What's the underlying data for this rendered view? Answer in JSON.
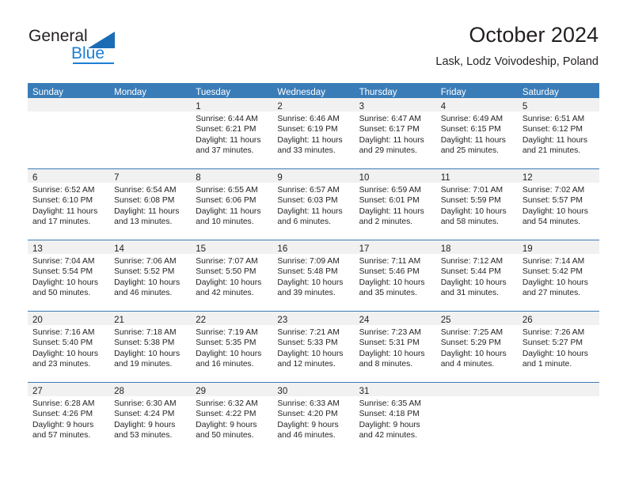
{
  "brand": {
    "name_primary": "General",
    "name_secondary": "Blue",
    "logo_icon": "blue-triangle-icon",
    "accent_color": "#1b7fd4"
  },
  "header": {
    "title": "October 2024",
    "subtitle": "Lask, Lodz Voivodeship, Poland"
  },
  "colors": {
    "header_bar": "#3a7cb8",
    "day_band": "#f1f1f1",
    "text": "#231f20"
  },
  "weekdays": [
    "Sunday",
    "Monday",
    "Tuesday",
    "Wednesday",
    "Thursday",
    "Friday",
    "Saturday"
  ],
  "weeks": [
    [
      {
        "day": "",
        "sunrise": "",
        "sunset": "",
        "daylight": "",
        "daylight2": ""
      },
      {
        "day": "",
        "sunrise": "",
        "sunset": "",
        "daylight": "",
        "daylight2": ""
      },
      {
        "day": "1",
        "sunrise": "Sunrise: 6:44 AM",
        "sunset": "Sunset: 6:21 PM",
        "daylight": "Daylight: 11 hours",
        "daylight2": "and 37 minutes."
      },
      {
        "day": "2",
        "sunrise": "Sunrise: 6:46 AM",
        "sunset": "Sunset: 6:19 PM",
        "daylight": "Daylight: 11 hours",
        "daylight2": "and 33 minutes."
      },
      {
        "day": "3",
        "sunrise": "Sunrise: 6:47 AM",
        "sunset": "Sunset: 6:17 PM",
        "daylight": "Daylight: 11 hours",
        "daylight2": "and 29 minutes."
      },
      {
        "day": "4",
        "sunrise": "Sunrise: 6:49 AM",
        "sunset": "Sunset: 6:15 PM",
        "daylight": "Daylight: 11 hours",
        "daylight2": "and 25 minutes."
      },
      {
        "day": "5",
        "sunrise": "Sunrise: 6:51 AM",
        "sunset": "Sunset: 6:12 PM",
        "daylight": "Daylight: 11 hours",
        "daylight2": "and 21 minutes."
      }
    ],
    [
      {
        "day": "6",
        "sunrise": "Sunrise: 6:52 AM",
        "sunset": "Sunset: 6:10 PM",
        "daylight": "Daylight: 11 hours",
        "daylight2": "and 17 minutes."
      },
      {
        "day": "7",
        "sunrise": "Sunrise: 6:54 AM",
        "sunset": "Sunset: 6:08 PM",
        "daylight": "Daylight: 11 hours",
        "daylight2": "and 13 minutes."
      },
      {
        "day": "8",
        "sunrise": "Sunrise: 6:55 AM",
        "sunset": "Sunset: 6:06 PM",
        "daylight": "Daylight: 11 hours",
        "daylight2": "and 10 minutes."
      },
      {
        "day": "9",
        "sunrise": "Sunrise: 6:57 AM",
        "sunset": "Sunset: 6:03 PM",
        "daylight": "Daylight: 11 hours",
        "daylight2": "and 6 minutes."
      },
      {
        "day": "10",
        "sunrise": "Sunrise: 6:59 AM",
        "sunset": "Sunset: 6:01 PM",
        "daylight": "Daylight: 11 hours",
        "daylight2": "and 2 minutes."
      },
      {
        "day": "11",
        "sunrise": "Sunrise: 7:01 AM",
        "sunset": "Sunset: 5:59 PM",
        "daylight": "Daylight: 10 hours",
        "daylight2": "and 58 minutes."
      },
      {
        "day": "12",
        "sunrise": "Sunrise: 7:02 AM",
        "sunset": "Sunset: 5:57 PM",
        "daylight": "Daylight: 10 hours",
        "daylight2": "and 54 minutes."
      }
    ],
    [
      {
        "day": "13",
        "sunrise": "Sunrise: 7:04 AM",
        "sunset": "Sunset: 5:54 PM",
        "daylight": "Daylight: 10 hours",
        "daylight2": "and 50 minutes."
      },
      {
        "day": "14",
        "sunrise": "Sunrise: 7:06 AM",
        "sunset": "Sunset: 5:52 PM",
        "daylight": "Daylight: 10 hours",
        "daylight2": "and 46 minutes."
      },
      {
        "day": "15",
        "sunrise": "Sunrise: 7:07 AM",
        "sunset": "Sunset: 5:50 PM",
        "daylight": "Daylight: 10 hours",
        "daylight2": "and 42 minutes."
      },
      {
        "day": "16",
        "sunrise": "Sunrise: 7:09 AM",
        "sunset": "Sunset: 5:48 PM",
        "daylight": "Daylight: 10 hours",
        "daylight2": "and 39 minutes."
      },
      {
        "day": "17",
        "sunrise": "Sunrise: 7:11 AM",
        "sunset": "Sunset: 5:46 PM",
        "daylight": "Daylight: 10 hours",
        "daylight2": "and 35 minutes."
      },
      {
        "day": "18",
        "sunrise": "Sunrise: 7:12 AM",
        "sunset": "Sunset: 5:44 PM",
        "daylight": "Daylight: 10 hours",
        "daylight2": "and 31 minutes."
      },
      {
        "day": "19",
        "sunrise": "Sunrise: 7:14 AM",
        "sunset": "Sunset: 5:42 PM",
        "daylight": "Daylight: 10 hours",
        "daylight2": "and 27 minutes."
      }
    ],
    [
      {
        "day": "20",
        "sunrise": "Sunrise: 7:16 AM",
        "sunset": "Sunset: 5:40 PM",
        "daylight": "Daylight: 10 hours",
        "daylight2": "and 23 minutes."
      },
      {
        "day": "21",
        "sunrise": "Sunrise: 7:18 AM",
        "sunset": "Sunset: 5:38 PM",
        "daylight": "Daylight: 10 hours",
        "daylight2": "and 19 minutes."
      },
      {
        "day": "22",
        "sunrise": "Sunrise: 7:19 AM",
        "sunset": "Sunset: 5:35 PM",
        "daylight": "Daylight: 10 hours",
        "daylight2": "and 16 minutes."
      },
      {
        "day": "23",
        "sunrise": "Sunrise: 7:21 AM",
        "sunset": "Sunset: 5:33 PM",
        "daylight": "Daylight: 10 hours",
        "daylight2": "and 12 minutes."
      },
      {
        "day": "24",
        "sunrise": "Sunrise: 7:23 AM",
        "sunset": "Sunset: 5:31 PM",
        "daylight": "Daylight: 10 hours",
        "daylight2": "and 8 minutes."
      },
      {
        "day": "25",
        "sunrise": "Sunrise: 7:25 AM",
        "sunset": "Sunset: 5:29 PM",
        "daylight": "Daylight: 10 hours",
        "daylight2": "and 4 minutes."
      },
      {
        "day": "26",
        "sunrise": "Sunrise: 7:26 AM",
        "sunset": "Sunset: 5:27 PM",
        "daylight": "Daylight: 10 hours",
        "daylight2": "and 1 minute."
      }
    ],
    [
      {
        "day": "27",
        "sunrise": "Sunrise: 6:28 AM",
        "sunset": "Sunset: 4:26 PM",
        "daylight": "Daylight: 9 hours",
        "daylight2": "and 57 minutes."
      },
      {
        "day": "28",
        "sunrise": "Sunrise: 6:30 AM",
        "sunset": "Sunset: 4:24 PM",
        "daylight": "Daylight: 9 hours",
        "daylight2": "and 53 minutes."
      },
      {
        "day": "29",
        "sunrise": "Sunrise: 6:32 AM",
        "sunset": "Sunset: 4:22 PM",
        "daylight": "Daylight: 9 hours",
        "daylight2": "and 50 minutes."
      },
      {
        "day": "30",
        "sunrise": "Sunrise: 6:33 AM",
        "sunset": "Sunset: 4:20 PM",
        "daylight": "Daylight: 9 hours",
        "daylight2": "and 46 minutes."
      },
      {
        "day": "31",
        "sunrise": "Sunrise: 6:35 AM",
        "sunset": "Sunset: 4:18 PM",
        "daylight": "Daylight: 9 hours",
        "daylight2": "and 42 minutes."
      },
      {
        "day": "",
        "sunrise": "",
        "sunset": "",
        "daylight": "",
        "daylight2": ""
      },
      {
        "day": "",
        "sunrise": "",
        "sunset": "",
        "daylight": "",
        "daylight2": ""
      }
    ]
  ]
}
